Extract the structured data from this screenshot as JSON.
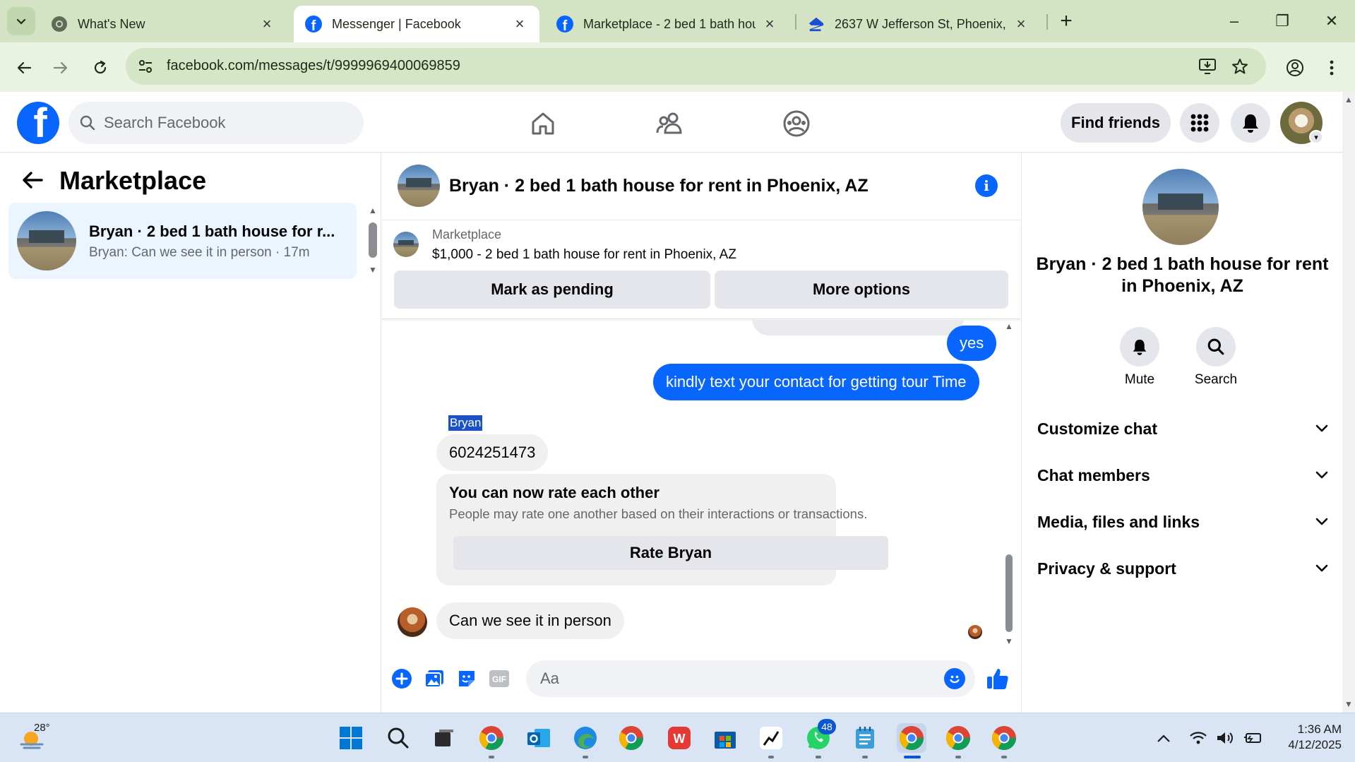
{
  "browser": {
    "tabs": [
      {
        "title": "What's New",
        "icon": "chrome-icon",
        "active": false
      },
      {
        "title": "Messenger | Facebook",
        "icon": "facebook-icon",
        "active": true
      },
      {
        "title": "Marketplace - 2 bed 1 bath hou",
        "icon": "facebook-icon",
        "active": false
      },
      {
        "title": "2637 W Jefferson St, Phoenix, A",
        "icon": "zillow-icon",
        "active": false
      }
    ],
    "new_tab": "+",
    "url": "facebook.com/messages/t/9999969400069859",
    "window_controls": {
      "minimize": "–",
      "restore": "❐",
      "close": "✕"
    }
  },
  "fb_header": {
    "logo_letter": "f",
    "search_placeholder": "Search Facebook",
    "find_friends": "Find friends"
  },
  "left": {
    "title": "Marketplace",
    "chat": {
      "name": "Bryan · 2 bed 1 bath house for r...",
      "preview": "Bryan: Can we see it in person · 17m"
    }
  },
  "conversation": {
    "title": "Bryan · 2 bed 1 bath house for rent in Phoenix, AZ",
    "info_icon": "i",
    "listing": {
      "label": "Marketplace",
      "title": "$1,000 - 2 bed 1 bath house for rent in Phoenix, AZ",
      "mark_pending": "Mark as pending",
      "more_options": "More options"
    },
    "messages": {
      "yes": "yes",
      "tour": "kindly text your contact for getting tour Time",
      "sender": "Bryan",
      "phone": "6024251473",
      "rate_title": "You can now rate each other",
      "rate_sub": "People may rate one another based on their interactions or transactions.",
      "rate_button": "Rate Bryan",
      "last": "Can we see it in person"
    },
    "composer_placeholder": "Aa"
  },
  "details": {
    "name": "Bryan · 2 bed 1 bath house for rent in Phoenix, AZ",
    "mute": "Mute",
    "search": "Search",
    "sections": [
      "Customize chat",
      "Chat members",
      "Media, files and links",
      "Privacy & support"
    ]
  },
  "taskbar": {
    "temperature": "28°",
    "whatsapp_badge": "48",
    "time": "1:36 AM",
    "date": "4/12/2025"
  },
  "colors": {
    "facebook_blue": "#0866ff",
    "chat_selected": "#ebf5ff",
    "browser_frame": "#d3e3c4"
  }
}
